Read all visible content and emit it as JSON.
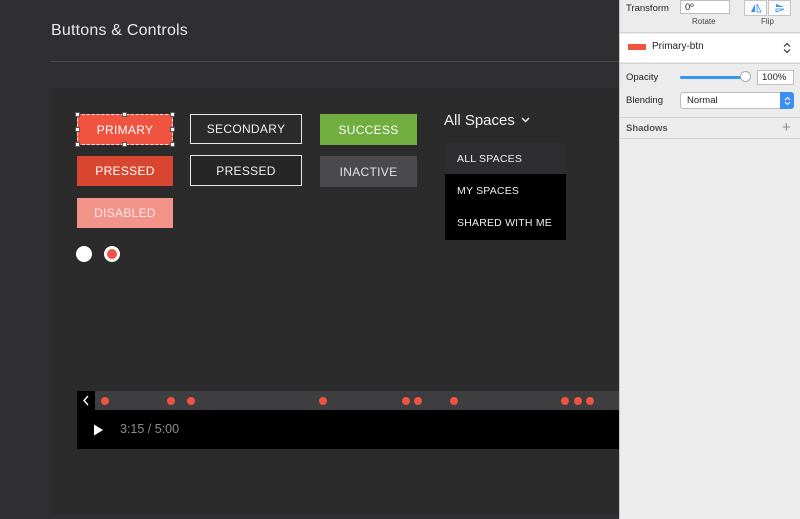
{
  "page": {
    "title": "Buttons & Controls"
  },
  "buttons": {
    "primary": "PRIMARY",
    "primary_pressed": "PRESSED",
    "primary_disabled": "DISABLED",
    "secondary": "SECONDARY",
    "secondary_pressed": "PRESSED",
    "success": "SUCCESS",
    "inactive": "INACTIVE"
  },
  "radios": [
    {
      "state": "unchecked"
    },
    {
      "state": "checked"
    }
  ],
  "dropdown": {
    "label": "All Spaces",
    "icon": "chevron-down-icon",
    "items": [
      {
        "label": "ALL SPACES",
        "active": true
      },
      {
        "label": "MY SPACES",
        "active": false
      },
      {
        "label": "SHARED WITH ME",
        "active": false
      }
    ]
  },
  "player": {
    "time": "3:15 / 5:00",
    "marker_count": 11,
    "icons": [
      "chevron-left-icon",
      "play-icon"
    ]
  },
  "inspector": {
    "transform_label": "Transform",
    "rotate_value": "0º",
    "rotate_label": "Rotate",
    "flip_label": "Flip",
    "symbol_name": "Primary-btn",
    "opacity_label": "Opacity",
    "opacity_value": "100%",
    "opacity_fraction": 1.0,
    "blending_label": "Blending",
    "blending_value": "Normal",
    "shadows_label": "Shadows",
    "add_label": "+"
  },
  "colors": {
    "primary": "#f0533f",
    "pressed": "#d9462f",
    "disabled": "#f2948a",
    "success": "#6fae3f",
    "inactive": "#4a4a4c",
    "accent": "#3b93f2"
  }
}
